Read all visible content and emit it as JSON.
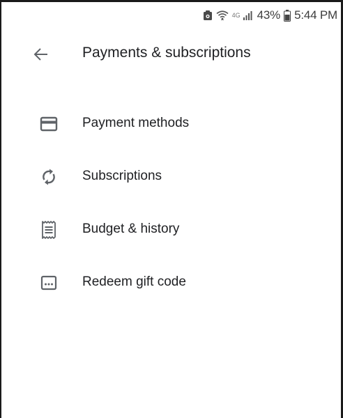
{
  "status_bar": {
    "icons": [
      "notification-icon",
      "wifi-icon",
      "lte-icon",
      "signal-icon",
      "battery-icon"
    ],
    "network": "4G",
    "battery": "43%",
    "time": "5:44 PM"
  },
  "app_bar": {
    "back_icon": "arrow-back-icon",
    "title": "Payments & subscriptions"
  },
  "menu": {
    "items": [
      {
        "icon": "credit-card-icon",
        "label": "Payment methods"
      },
      {
        "icon": "sync-icon",
        "label": "Subscriptions"
      },
      {
        "icon": "receipt-icon",
        "label": "Budget & history"
      },
      {
        "icon": "gift-code-icon",
        "label": "Redeem gift code"
      }
    ]
  },
  "colors": {
    "text_primary": "#202124",
    "icon": "#5f6368",
    "background": "#ffffff"
  }
}
